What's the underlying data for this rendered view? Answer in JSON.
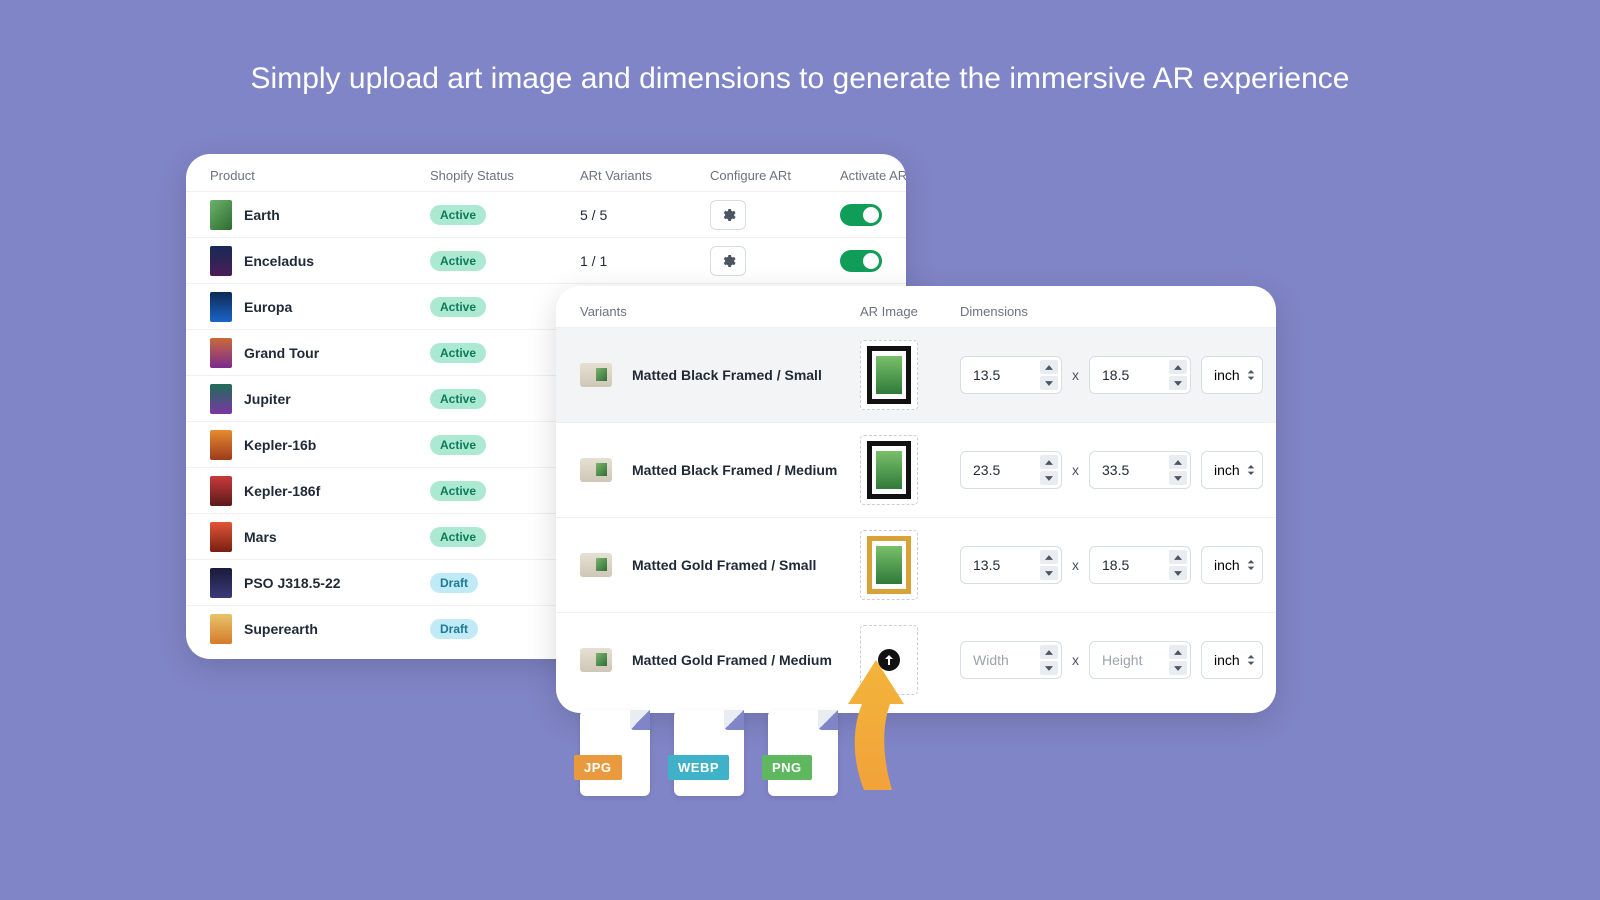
{
  "headline": "Simply upload art image and dimensions to generate the immersive AR experience",
  "product_table": {
    "headers": {
      "product": "Product",
      "shopify_status": "Shopify Status",
      "art_variants": "ARt Variants",
      "configure": "Configure ARt",
      "activate": "Activate ARt"
    },
    "rows": [
      {
        "name": "Earth",
        "status": "Active",
        "status_kind": "active",
        "variants": "5 / 5",
        "has_gear": true,
        "toggle": true,
        "thumb": "a"
      },
      {
        "name": "Enceladus",
        "status": "Active",
        "status_kind": "active",
        "variants": "1 / 1",
        "has_gear": true,
        "toggle": true,
        "thumb": "b"
      },
      {
        "name": "Europa",
        "status": "Active",
        "status_kind": "active",
        "variants": "",
        "has_gear": false,
        "toggle": false,
        "thumb": "c"
      },
      {
        "name": "Grand Tour",
        "status": "Active",
        "status_kind": "active",
        "variants": "",
        "has_gear": false,
        "toggle": false,
        "thumb": "d"
      },
      {
        "name": "Jupiter",
        "status": "Active",
        "status_kind": "active",
        "variants": "",
        "has_gear": false,
        "toggle": false,
        "thumb": "e"
      },
      {
        "name": "Kepler-16b",
        "status": "Active",
        "status_kind": "active",
        "variants": "",
        "has_gear": false,
        "toggle": false,
        "thumb": "f"
      },
      {
        "name": "Kepler-186f",
        "status": "Active",
        "status_kind": "active",
        "variants": "",
        "has_gear": false,
        "toggle": false,
        "thumb": "g"
      },
      {
        "name": "Mars",
        "status": "Active",
        "status_kind": "active",
        "variants": "",
        "has_gear": false,
        "toggle": false,
        "thumb": "h"
      },
      {
        "name": "PSO J318.5-22",
        "status": "Draft",
        "status_kind": "draft",
        "variants": "",
        "has_gear": false,
        "toggle": false,
        "thumb": "i"
      },
      {
        "name": "Superearth",
        "status": "Draft",
        "status_kind": "draft",
        "variants": "",
        "has_gear": false,
        "toggle": false,
        "thumb": "j"
      }
    ]
  },
  "variant_panel": {
    "headers": {
      "variants": "Variants",
      "ar_image": "AR Image",
      "dimensions": "Dimensions"
    },
    "x_label": "x",
    "unit": "inch",
    "width_placeholder": "Width",
    "height_placeholder": "Height",
    "rows": [
      {
        "name": "Matted Black Framed / Small",
        "frame": "black",
        "has_image": true,
        "w": "13.5",
        "h": "18.5",
        "selected": true
      },
      {
        "name": "Matted Black Framed / Medium",
        "frame": "black",
        "has_image": true,
        "w": "23.5",
        "h": "33.5",
        "selected": false
      },
      {
        "name": "Matted Gold Framed / Small",
        "frame": "gold",
        "has_image": true,
        "w": "13.5",
        "h": "18.5",
        "selected": false
      },
      {
        "name": "Matted Gold Framed / Medium",
        "frame": "gold",
        "has_image": false,
        "w": "",
        "h": "",
        "selected": false
      }
    ]
  },
  "file_tags": {
    "jpg": "JPG",
    "webp": "WEBP",
    "png": "PNG"
  }
}
